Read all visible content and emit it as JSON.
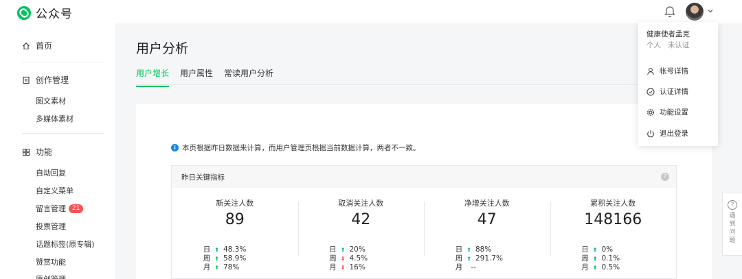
{
  "app": {
    "title": "公众号",
    "brand_color": "#07c160"
  },
  "header": {
    "bell_icon": "bell-icon",
    "caret_icon": "chevron-down-icon"
  },
  "sidebar": {
    "home": "首页",
    "creation": {
      "label": "创作管理",
      "items": [
        "图文素材",
        "多媒体素材"
      ]
    },
    "features": {
      "label": "功能",
      "items": [
        "自动回复",
        "自定义菜单",
        "留言管理",
        "投票管理",
        "话题标签(原专辑)",
        "赞赏功能",
        "原创管理"
      ],
      "message_badge": "21"
    }
  },
  "main": {
    "title": "用户分析",
    "tabs": [
      "用户增长",
      "用户属性",
      "常读用户分析"
    ],
    "active_tab": 0,
    "notice": "本页根据昨日数据来计算，而用户管理页根据当前数据计算，两者不一致。",
    "metrics_title": "昨日关键指标",
    "help_mark": "?",
    "metrics": [
      {
        "label": "新关注人数",
        "value": "89",
        "comparisons": [
          {
            "period": "日",
            "dir": "up",
            "value": "48.3%"
          },
          {
            "period": "周",
            "dir": "up",
            "value": "58.9%"
          },
          {
            "period": "月",
            "dir": "up",
            "value": "78%"
          }
        ]
      },
      {
        "label": "取消关注人数",
        "value": "42",
        "comparisons": [
          {
            "period": "日",
            "dir": "up",
            "value": "20%"
          },
          {
            "period": "周",
            "dir": "down",
            "value": "4.5%"
          },
          {
            "period": "月",
            "dir": "down",
            "value": "16%"
          }
        ]
      },
      {
        "label": "净增关注人数",
        "value": "47",
        "comparisons": [
          {
            "period": "日",
            "dir": "up",
            "value": "88%"
          },
          {
            "period": "周",
            "dir": "up",
            "value": "291.7%"
          },
          {
            "period": "月",
            "dir": "none",
            "value": "--"
          }
        ]
      },
      {
        "label": "累积关注人数",
        "value": "148166",
        "comparisons": [
          {
            "period": "日",
            "dir": "up",
            "value": "0%"
          },
          {
            "period": "周",
            "dir": "up",
            "value": "0.1%"
          },
          {
            "period": "月",
            "dir": "up",
            "value": "0.5%"
          }
        ]
      }
    ]
  },
  "dropdown": {
    "name": "健康使者孟克",
    "type": "个人",
    "verify": "未认证",
    "items": [
      {
        "label": "帐号详情",
        "icon": "user-icon"
      },
      {
        "label": "认证详情",
        "icon": "check-circle-icon"
      },
      {
        "label": "功能设置",
        "icon": "gear-icon"
      },
      {
        "label": "退出登录",
        "icon": "power-icon"
      }
    ]
  },
  "help_float": {
    "mark": "?",
    "text": "遇到问题"
  }
}
